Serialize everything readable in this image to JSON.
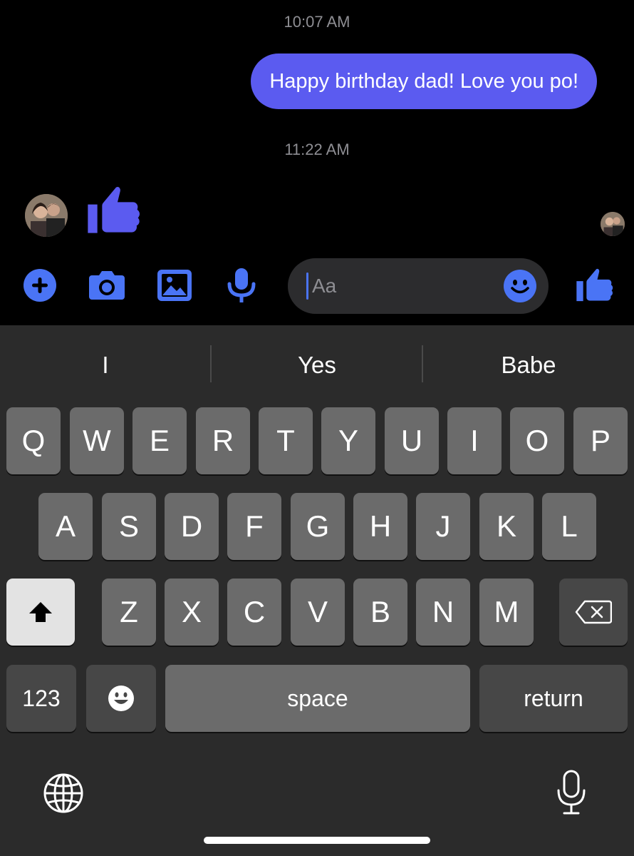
{
  "conversation": {
    "timestamp_1": "10:07 AM",
    "sent_message": "Happy birthday dad! Love you po!",
    "timestamp_2": "11:22 AM"
  },
  "composer": {
    "placeholder": "Aa",
    "accent_color": "#4a74f5"
  },
  "keyboard": {
    "suggestions": [
      "I",
      "Yes",
      "Babe"
    ],
    "row1": [
      "Q",
      "W",
      "E",
      "R",
      "T",
      "Y",
      "U",
      "I",
      "O",
      "P"
    ],
    "row2": [
      "A",
      "S",
      "D",
      "F",
      "G",
      "H",
      "J",
      "K",
      "L"
    ],
    "row3": [
      "Z",
      "X",
      "C",
      "V",
      "B",
      "N",
      "M"
    ],
    "numbers_label": "123",
    "space_label": "space",
    "return_label": "return"
  }
}
